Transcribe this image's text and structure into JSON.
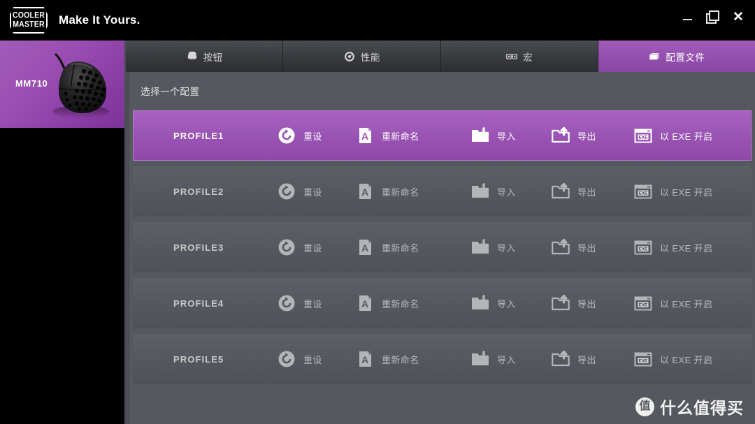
{
  "window": {
    "brand_line1": "COOLER",
    "brand_line2": "MASTER",
    "tagline": "Make It Yours.",
    "minimize_label": "–",
    "maximize_label": "❐",
    "close_label": "✕"
  },
  "sidebar": {
    "device_name": "MM710",
    "device_icon": "gaming-mouse"
  },
  "tabs": [
    {
      "label": "按钮",
      "icon": "mouse-icon",
      "active": false
    },
    {
      "label": "性能",
      "icon": "gauge-icon",
      "active": false
    },
    {
      "label": "宏",
      "icon": "macro-icon",
      "active": false
    },
    {
      "label": "配置文件",
      "icon": "layers-icon",
      "active": true
    }
  ],
  "main": {
    "section_title": "选择一个配置",
    "actions": {
      "reset": "重设",
      "rename": "重新命名",
      "import": "导入",
      "export": "导出",
      "launch_exe": "以 EXE 开启",
      "exe_glyph": "EXE"
    },
    "profiles": [
      {
        "name": "PROFILE1",
        "active": true
      },
      {
        "name": "PROFILE2",
        "active": false
      },
      {
        "name": "PROFILE3",
        "active": false
      },
      {
        "name": "PROFILE4",
        "active": false
      },
      {
        "name": "PROFILE5",
        "active": false
      }
    ]
  },
  "watermark": {
    "badge": "值",
    "text": "什么值得买"
  },
  "colors": {
    "accent_purple": "#9a54b3",
    "accent_purple_light": "#a962c0",
    "panel_gray": "#55585e",
    "row_gray": "#5c5f65",
    "tab_dark": "#37393d",
    "black": "#000000"
  }
}
